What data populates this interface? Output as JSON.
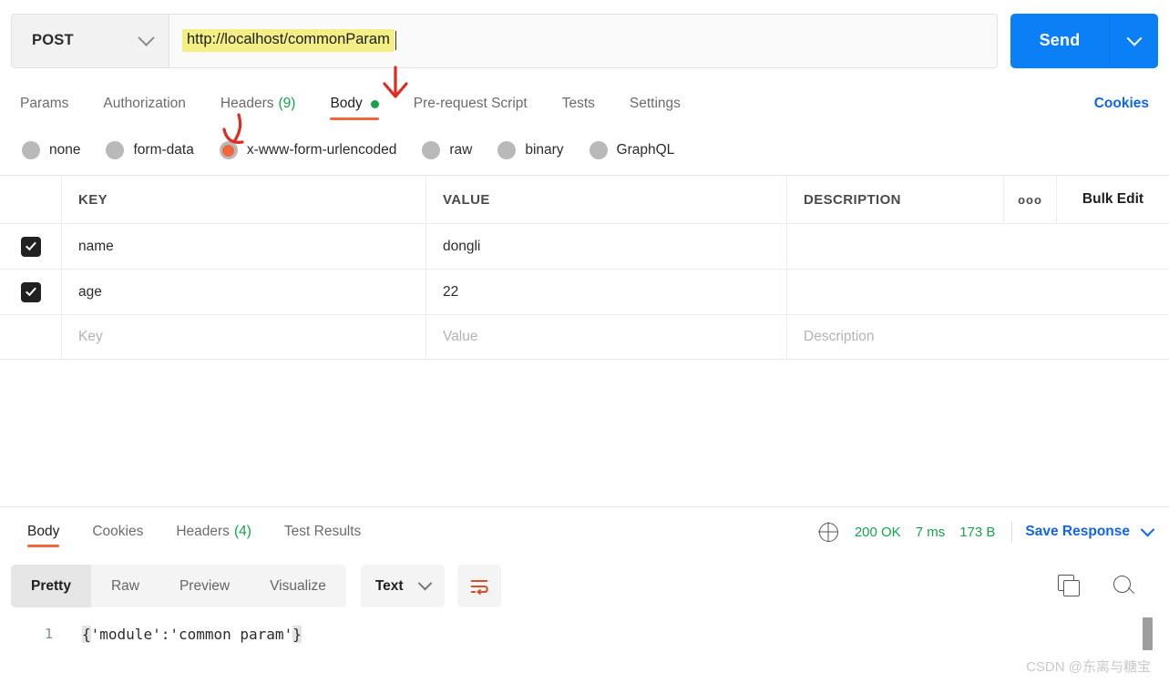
{
  "request": {
    "method": "POST",
    "method_icon": "chevron-down-icon",
    "url": "http://localhost/commonParam",
    "send_label": "Send",
    "send_caret_icon": "chevron-down-icon"
  },
  "request_tabs": [
    {
      "label": "Params",
      "active": false
    },
    {
      "label": "Authorization",
      "active": false
    },
    {
      "label": "Headers",
      "count": "(9)",
      "active": false
    },
    {
      "label": "Body",
      "active": true,
      "dot": true
    },
    {
      "label": "Pre-request Script",
      "active": false
    },
    {
      "label": "Tests",
      "active": false
    },
    {
      "label": "Settings",
      "active": false
    }
  ],
  "cookies_link": "Cookies",
  "body_types": [
    {
      "label": "none",
      "selected": false
    },
    {
      "label": "form-data",
      "selected": false
    },
    {
      "label": "x-www-form-urlencoded",
      "selected": true
    },
    {
      "label": "raw",
      "selected": false
    },
    {
      "label": "binary",
      "selected": false
    },
    {
      "label": "GraphQL",
      "selected": false
    }
  ],
  "param_table": {
    "headers": {
      "key": "KEY",
      "value": "VALUE",
      "description": "DESCRIPTION"
    },
    "more_icon": "ooo",
    "bulk_edit": "Bulk Edit",
    "rows": [
      {
        "checked": true,
        "key": "name",
        "value": "dongli",
        "description": ""
      },
      {
        "checked": true,
        "key": "age",
        "value": "22",
        "description": ""
      }
    ],
    "placeholder_row": {
      "key": "Key",
      "value": "Value",
      "description": "Description"
    }
  },
  "response": {
    "tabs": [
      {
        "label": "Body",
        "active": true
      },
      {
        "label": "Cookies",
        "active": false
      },
      {
        "label": "Headers",
        "count": "(4)",
        "active": false
      },
      {
        "label": "Test Results",
        "active": false
      }
    ],
    "globe_icon": "globe-icon",
    "status": "200 OK",
    "time": "7 ms",
    "size": "173 B",
    "save_label": "Save Response",
    "save_caret_icon": "chevron-down-icon",
    "view_modes": [
      {
        "label": "Pretty",
        "active": true
      },
      {
        "label": "Raw",
        "active": false
      },
      {
        "label": "Preview",
        "active": false
      },
      {
        "label": "Visualize",
        "active": false
      }
    ],
    "format": "Text",
    "format_caret_icon": "chevron-down-icon",
    "wrap_icon": "wrap-text-icon",
    "copy_icon": "copy-icon",
    "search_icon": "search-icon",
    "body_line_number": "1",
    "body_open_brace": "{",
    "body_content": "'module':'common param'",
    "body_close_brace": "}"
  },
  "watermark": "CSDN @东离与糖宝",
  "colors": {
    "accent_orange": "#f2663c",
    "link_blue": "#1264e8",
    "send_blue": "#0b7ff5",
    "status_green": "#16a34a",
    "highlight_yellow": "#f3ef84",
    "annotation_red": "#e02b20"
  }
}
